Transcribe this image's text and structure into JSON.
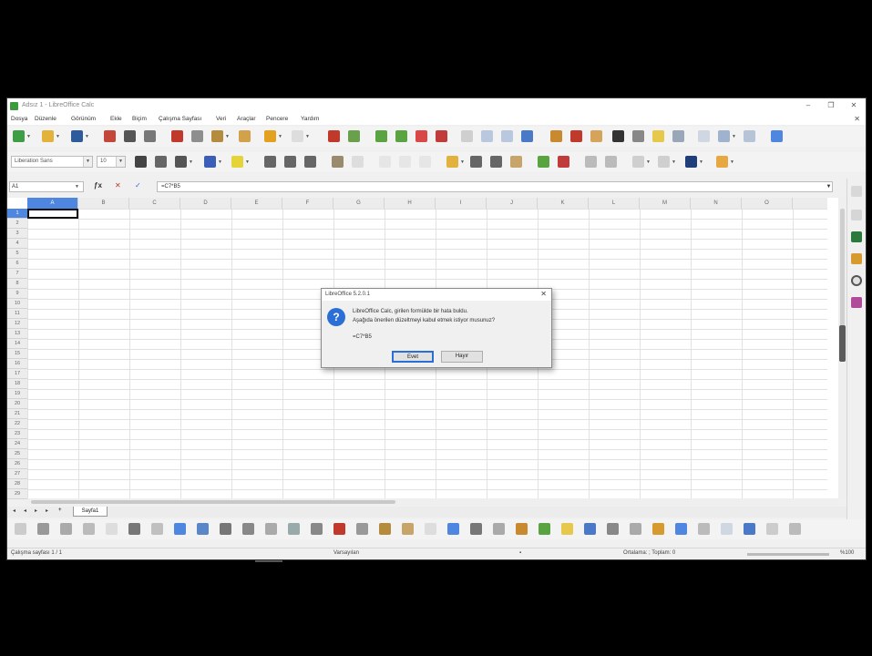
{
  "window": {
    "title": "Adsız 1 - LibreOffice Calc",
    "controls": [
      "‒",
      "❐",
      "✕"
    ]
  },
  "menu": [
    "Dosya",
    "Düzenle",
    "Görünüm",
    "Ekle",
    "Biçim",
    "Çalışma Sayfası",
    "Veri",
    "Araçlar",
    "Pencere",
    "Yardım"
  ],
  "toolbar_font": {
    "font_name": "Liberation Sans",
    "font_size": "10"
  },
  "formula_bar": {
    "cell_ref": "A1",
    "content": "=C7*B5"
  },
  "grid": {
    "columns": [
      "A",
      "B",
      "C",
      "D",
      "E",
      "F",
      "G",
      "H",
      "I",
      "J",
      "K",
      "L",
      "M",
      "N",
      "O"
    ],
    "rows": [
      "1",
      "2",
      "3",
      "4",
      "5",
      "6",
      "7",
      "8",
      "9",
      "10",
      "11",
      "12",
      "13",
      "14",
      "15",
      "16",
      "17",
      "18",
      "19",
      "20",
      "21",
      "22",
      "23",
      "24",
      "25",
      "26",
      "27",
      "28",
      "29"
    ],
    "selected_col": "A",
    "selected_row": "1"
  },
  "sheet_tabs": [
    "Sayfa1"
  ],
  "status_bar": {
    "sheet": "Çalışma sayfası 1 / 1",
    "style": "Varsayılan",
    "stats": "Ortalama: ; Toplam: 0",
    "zoom": "%100"
  },
  "dialog": {
    "title": "LibreOffice 5.2.0.1",
    "message_line1": "LibreOffice Calc, girilen formülde bir hata buldu.",
    "message_line2": "Aşağıda önerilen düzeltmeyi kabul etmek istiyor musunuz?",
    "formula": "=C7*B5",
    "yes_label": "Evet",
    "no_label": "Hayır",
    "icon": "question-icon"
  },
  "colors": {
    "accent": "#4f86e0",
    "dialog_icon": "#2b6fd6"
  }
}
